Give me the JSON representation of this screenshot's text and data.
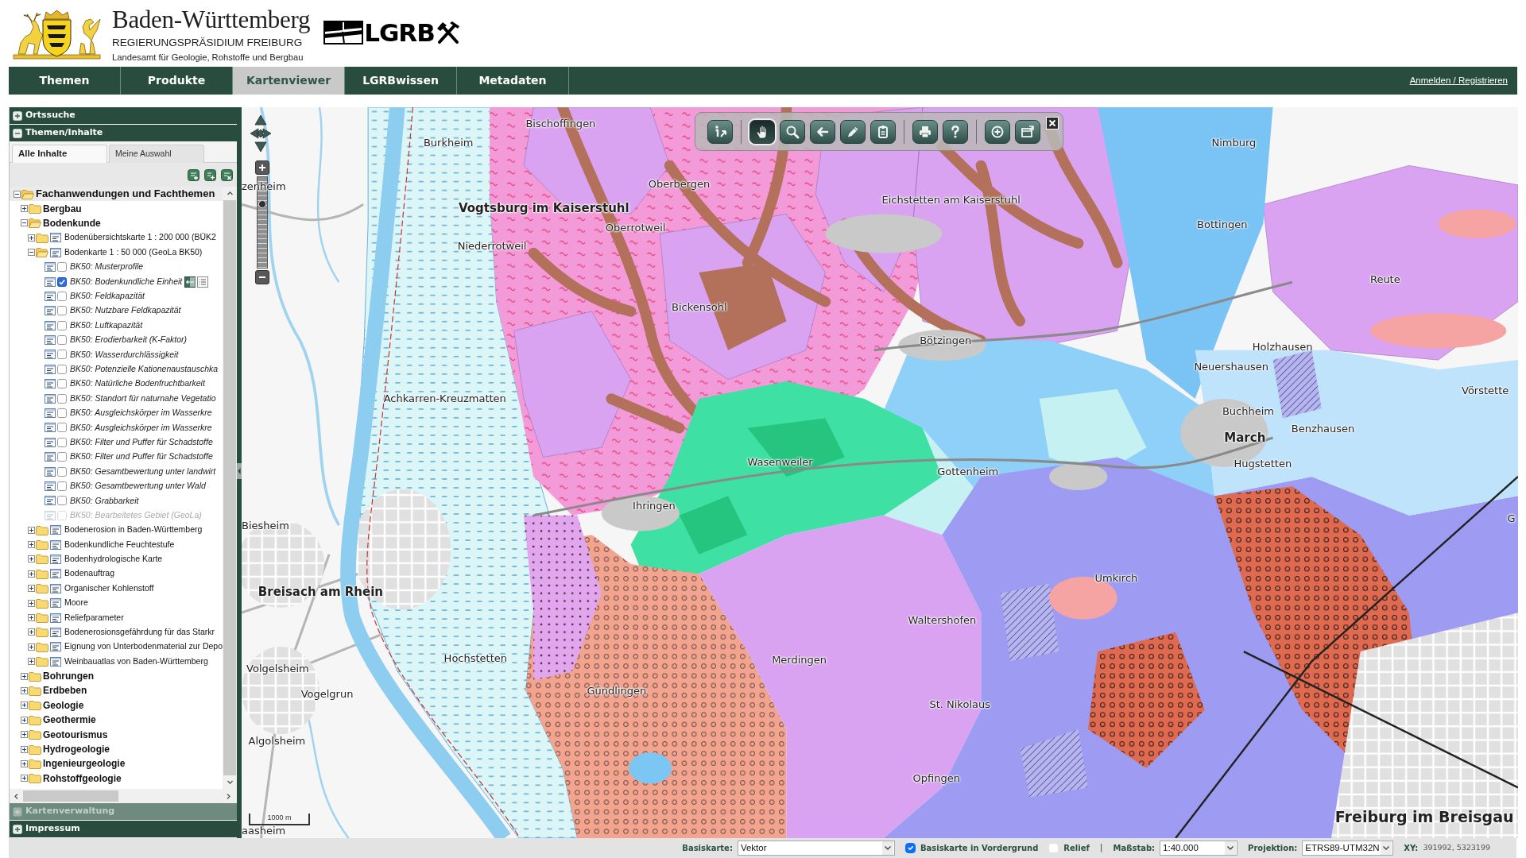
{
  "header": {
    "title": "Baden-Württemberg",
    "subtitle": "REGIERUNGSPRÄSIDIUM FREIBURG",
    "agency": "Landesamt für Geologie, Rohstoffe und Bergbau",
    "logo_text": "LGRB"
  },
  "nav": {
    "tabs": [
      {
        "label": "Themen",
        "selected": false
      },
      {
        "label": "Produkte",
        "selected": false
      },
      {
        "label": "Kartenviewer",
        "selected": true
      },
      {
        "label": "LGRBwissen",
        "selected": false
      },
      {
        "label": "Metadaten",
        "selected": false
      }
    ],
    "login": "Anmelden / Registrieren"
  },
  "sidebar": {
    "sections": [
      {
        "title": "Ortssuche",
        "expanded": false,
        "disabled": false
      },
      {
        "title": "Themen/Inhalte",
        "expanded": true,
        "disabled": false
      },
      {
        "title": "Kartenverwaltung",
        "expanded": false,
        "disabled": true
      },
      {
        "title": "Impressum",
        "expanded": false,
        "disabled": false
      }
    ],
    "tabs": [
      {
        "label": "Alle Inhalte",
        "selected": true
      },
      {
        "label": "Meine Auswahl",
        "selected": false
      }
    ],
    "tools": [
      {
        "kind": "add"
      },
      {
        "kind": "add_all"
      },
      {
        "kind": "clear"
      }
    ],
    "tree": [
      {
        "label": "Fachanwendungen und Fachthemen",
        "kind": "folder",
        "expanded": true,
        "children": [
          {
            "label": "Bergbau",
            "kind": "folder",
            "expanded": false
          },
          {
            "label": "Bodenkunde",
            "kind": "folder",
            "expanded": true,
            "children": [
              {
                "label": "Bodenübersichtskarte 1 : 200 000 (BÜK2",
                "kind": "group",
                "expanded": false
              },
              {
                "label": "Bodenkarte 1 : 50 000 (GeoLa BK50)",
                "kind": "group",
                "expanded": true,
                "children": [
                  {
                    "label": "BK50: Musterprofile",
                    "kind": "layer",
                    "checked": false,
                    "disabled": false
                  },
                  {
                    "label": "BK50: Bodenkundliche Einheit",
                    "kind": "layer",
                    "checked": true,
                    "disabled": false
                  },
                  {
                    "label": "BK50: Feldkapazität",
                    "kind": "layer",
                    "checked": false,
                    "disabled": false
                  },
                  {
                    "label": "BK50: Nutzbare Feldkapazität",
                    "kind": "layer",
                    "checked": false,
                    "disabled": false
                  },
                  {
                    "label": "BK50: Luftkapazität",
                    "kind": "layer",
                    "checked": false,
                    "disabled": false
                  },
                  {
                    "label": "BK50: Erodierbarkeit (K-Faktor)",
                    "kind": "layer",
                    "checked": false,
                    "disabled": false
                  },
                  {
                    "label": "BK50: Wasserdurchlässigkeit",
                    "kind": "layer",
                    "checked": false,
                    "disabled": false
                  },
                  {
                    "label": "BK50: Potenzielle Kationenaustauschka",
                    "kind": "layer",
                    "checked": false,
                    "disabled": false
                  },
                  {
                    "label": "BK50: Natürliche Bodenfruchtbarkeit",
                    "kind": "layer",
                    "checked": false,
                    "disabled": false
                  },
                  {
                    "label": "BK50: Standort für naturnahe Vegetatio",
                    "kind": "layer",
                    "checked": false,
                    "disabled": false
                  },
                  {
                    "label": "BK50: Ausgleichskörper im Wasserkre",
                    "kind": "layer",
                    "checked": false,
                    "disabled": false
                  },
                  {
                    "label": "BK50: Ausgleichskörper im Wasserkre",
                    "kind": "layer",
                    "checked": false,
                    "disabled": false
                  },
                  {
                    "label": "BK50: Filter und Puffer für Schadstoffe",
                    "kind": "layer",
                    "checked": false,
                    "disabled": false
                  },
                  {
                    "label": "BK50: Filter und Puffer für Schadstoffe",
                    "kind": "layer",
                    "checked": false,
                    "disabled": false
                  },
                  {
                    "label": "BK50: Gesamtbewertung unter landwirt",
                    "kind": "layer",
                    "checked": false,
                    "disabled": false
                  },
                  {
                    "label": "BK50: Gesamtbewertung unter Wald",
                    "kind": "layer",
                    "checked": false,
                    "disabled": false
                  },
                  {
                    "label": "BK50: Grabbarkeit",
                    "kind": "layer",
                    "checked": false,
                    "disabled": false
                  },
                  {
                    "label": "BK50: Bearbeitetes Gebiet (GeoLa)",
                    "kind": "layer",
                    "checked": false,
                    "disabled": true
                  }
                ]
              },
              {
                "label": "Bodenerosion in Baden-Württemberg",
                "kind": "group",
                "expanded": false
              },
              {
                "label": "Bodenkundliche Feuchtestufe",
                "kind": "group",
                "expanded": false
              },
              {
                "label": "Bodenhydrologische Karte",
                "kind": "group",
                "expanded": false
              },
              {
                "label": "Bodenauftrag",
                "kind": "group",
                "expanded": false
              },
              {
                "label": "Organischer Kohlenstoff",
                "kind": "group",
                "expanded": false
              },
              {
                "label": "Moore",
                "kind": "group",
                "expanded": false
              },
              {
                "label": "Reliefparameter",
                "kind": "group",
                "expanded": false
              },
              {
                "label": "Bodenerosionsgefährdung für das Starkr",
                "kind": "group",
                "expanded": false
              },
              {
                "label": "Eignung von Unterbodenmaterial zur Depo",
                "kind": "group",
                "expanded": false
              },
              {
                "label": "Weinbauatlas von Baden-Württemberg",
                "kind": "group",
                "expanded": false
              }
            ]
          },
          {
            "label": "Bohrungen",
            "kind": "folder",
            "expanded": false
          },
          {
            "label": "Erdbeben",
            "kind": "folder",
            "expanded": false
          },
          {
            "label": "Geologie",
            "kind": "folder",
            "expanded": false
          },
          {
            "label": "Geothermie",
            "kind": "folder",
            "expanded": false
          },
          {
            "label": "Geotourismus",
            "kind": "folder",
            "expanded": false
          },
          {
            "label": "Hydrogeologie",
            "kind": "folder",
            "expanded": false
          },
          {
            "label": "Ingenieurgeologie",
            "kind": "folder",
            "expanded": false
          },
          {
            "label": "Rohstoffgeologie",
            "kind": "folder",
            "expanded": false
          }
        ]
      }
    ]
  },
  "map": {
    "toolbar": [
      {
        "buttons": [
          {
            "kind": "info",
            "selected": false
          }
        ]
      },
      {
        "buttons": [
          {
            "kind": "pan",
            "selected": true
          },
          {
            "kind": "zoom",
            "selected": false
          },
          {
            "kind": "back",
            "selected": false
          },
          {
            "kind": "measure",
            "selected": false
          },
          {
            "kind": "select",
            "selected": false
          }
        ]
      },
      {
        "buttons": [
          {
            "kind": "print",
            "selected": false
          },
          {
            "kind": "help",
            "selected": false
          }
        ]
      },
      {
        "buttons": [
          {
            "kind": "add_layer",
            "selected": false
          },
          {
            "kind": "export",
            "selected": false
          }
        ]
      }
    ],
    "zoom_slider": {
      "level": 0.7
    },
    "labels": [
      {
        "text": "Bischoffingen",
        "kind": "town"
      },
      {
        "text": "Burkheim",
        "kind": "town"
      },
      {
        "text": "Nimburg",
        "kind": "town"
      },
      {
        "text": "Oberbergen",
        "kind": "town"
      },
      {
        "text": "zenheim",
        "kind": "town"
      },
      {
        "text": "Eichstetten am Kaiserstuhl",
        "kind": "town"
      },
      {
        "text": "Vogtsburg im Kaiserstuhl",
        "kind": "city"
      },
      {
        "text": "Bottingen",
        "kind": "town"
      },
      {
        "text": "Oberrotweil",
        "kind": "town"
      },
      {
        "text": "Niederrotweil",
        "kind": "town"
      },
      {
        "text": "Reute",
        "kind": "town"
      },
      {
        "text": "Bickensohl",
        "kind": "town"
      },
      {
        "text": "Bötzingen",
        "kind": "town"
      },
      {
        "text": "Holzhausen",
        "kind": "town"
      },
      {
        "text": "Neuershausen",
        "kind": "town"
      },
      {
        "text": "Vörstette",
        "kind": "town"
      },
      {
        "text": "Achkarren-Kreuzmatten",
        "kind": "town"
      },
      {
        "text": "Buchheim",
        "kind": "town"
      },
      {
        "text": "Benzhausen",
        "kind": "town"
      },
      {
        "text": "March",
        "kind": "city"
      },
      {
        "text": "Wasenweiler",
        "kind": "town"
      },
      {
        "text": "Hugstetten",
        "kind": "town"
      },
      {
        "text": "Gottenheim",
        "kind": "town"
      },
      {
        "text": "Ihringen",
        "kind": "town"
      },
      {
        "text": "G",
        "kind": "town"
      },
      {
        "text": "Biesheim",
        "kind": "town"
      },
      {
        "text": "Umkirch",
        "kind": "town"
      },
      {
        "text": "Breisach am Rhein",
        "kind": "city"
      },
      {
        "text": "Waltershofen",
        "kind": "town"
      },
      {
        "text": "Hochstetten",
        "kind": "town"
      },
      {
        "text": "Merdingen",
        "kind": "town"
      },
      {
        "text": "Volgelsheim",
        "kind": "town"
      },
      {
        "text": "Gündlingen",
        "kind": "town"
      },
      {
        "text": "Vogelgrun",
        "kind": "town"
      },
      {
        "text": "St. Nikolaus",
        "kind": "town"
      },
      {
        "text": "Algolsheim",
        "kind": "town"
      },
      {
        "text": "Opfingen",
        "kind": "town"
      },
      {
        "text": "Freiburg im Breisgau",
        "kind": "major_city"
      },
      {
        "text": "aasheim",
        "kind": "town"
      }
    ],
    "scale_bar": "1000 m"
  },
  "status_bar": {
    "items": [
      {
        "kind": "select",
        "label": "Basiskarte:",
        "value": "Vektor"
      },
      {
        "kind": "checkbox",
        "label": "Basiskarte in Vordergrund",
        "checked": true
      },
      {
        "kind": "checkbox",
        "label": "Relief",
        "checked": false
      },
      {
        "kind": "divider",
        "text": "|"
      },
      {
        "kind": "select",
        "label": "Maßstab:",
        "value": "1:40.000"
      },
      {
        "kind": "select",
        "label": "Projektion:",
        "value": "ETRS89-UTM32N"
      },
      {
        "kind": "readout",
        "label": "XY:",
        "value": "391992, 5323199"
      }
    ]
  }
}
